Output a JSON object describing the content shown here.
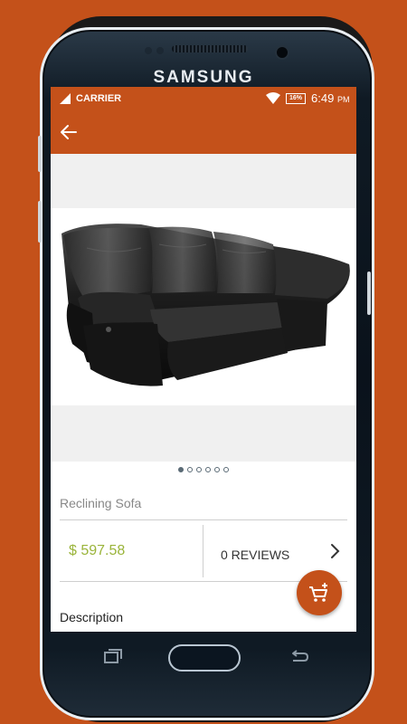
{
  "device": {
    "brand": "SAMSUNG"
  },
  "status_bar": {
    "carrier": "CARRIER",
    "battery": "16%",
    "time": "6:49",
    "ampm": "PM"
  },
  "app_bar": {
    "back_icon": "arrow-left-icon"
  },
  "gallery": {
    "image_subject": "black leather reclining sofa",
    "dot_count": 6,
    "active_index": 0
  },
  "product": {
    "name": "Reclining Sofa",
    "price": "$ 597.58",
    "reviews_label": "0 REVIEWS",
    "description_heading": "Description"
  },
  "fab": {
    "icon": "add-to-cart-icon"
  },
  "colors": {
    "accent": "#c4511a",
    "price": "#9ab43a"
  }
}
